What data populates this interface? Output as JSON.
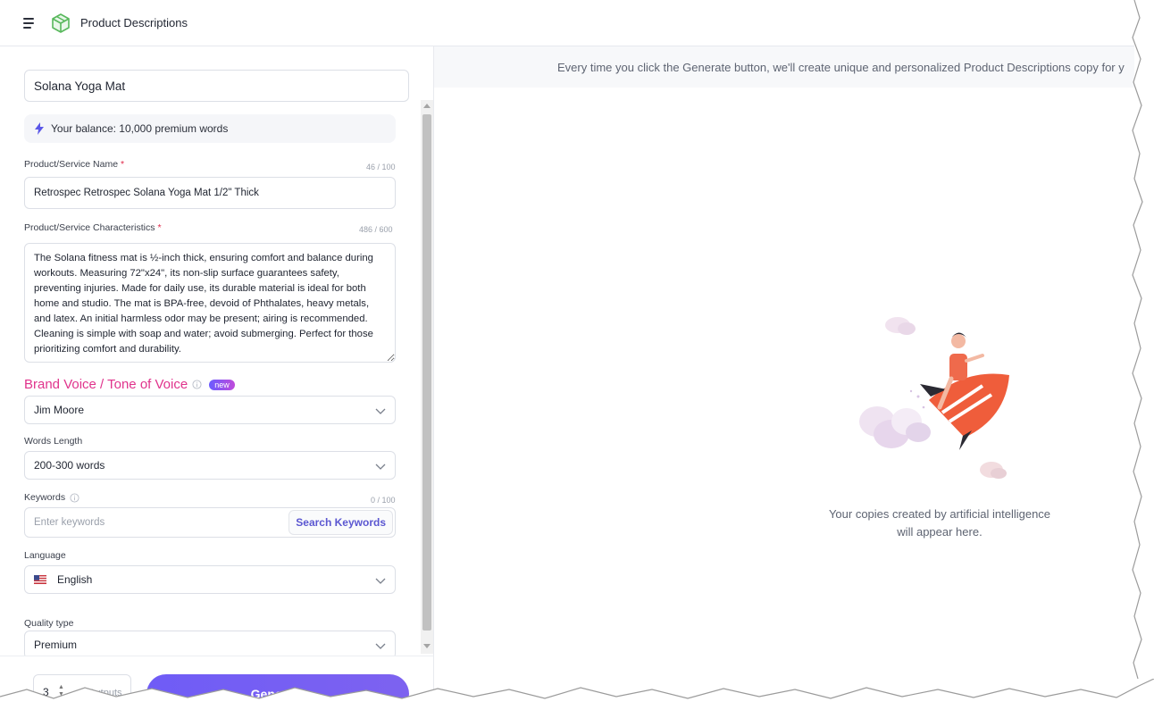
{
  "header": {
    "title": "Product Descriptions",
    "menu_icon": "hamburger-menu-icon",
    "logo_icon": "box-3d-icon"
  },
  "form": {
    "project_name": "Solana Yoga Mat",
    "balance_text": "Your balance: 10,000 premium words",
    "product_name": {
      "label": "Product/Service Name",
      "required_mark": "*",
      "counter": "46 / 100",
      "value": "Retrospec Retrospec Solana Yoga Mat 1/2\" Thick"
    },
    "characteristics": {
      "label": "Product/Service Characteristics",
      "required_mark": "*",
      "counter": "486 / 600",
      "value": "The Solana fitness mat is ½-inch thick, ensuring comfort and balance during workouts. Measuring 72\"x24\", its non-slip surface guarantees safety, preventing injuries. Made for daily use, its durable material is ideal for both home and studio. The mat is BPA-free, devoid of Phthalates, heavy metals, and latex. An initial harmless odor may be present; airing is recommended. Cleaning is simple with soap and water; avoid submerging. Perfect for those prioritizing comfort and durability."
    },
    "brand_voice": {
      "title": "Brand Voice / Tone of Voice",
      "badge": "new",
      "selected": "Jim Moore"
    },
    "words_length": {
      "label": "Words Length",
      "selected": "200-300 words"
    },
    "keywords": {
      "label": "Keywords",
      "counter": "0 / 100",
      "placeholder": "Enter keywords",
      "button": "Search Keywords"
    },
    "language": {
      "label": "Language",
      "selected": "English",
      "flag_icon": "us-flag-icon"
    },
    "quality_type": {
      "label": "Quality type",
      "selected": "Premium"
    }
  },
  "footer": {
    "outputs_value": "3",
    "outputs_label": "Outputs",
    "generate_label": "Generate"
  },
  "output_panel": {
    "banner": "Every time you click the Generate button, we'll create unique and personalized Product Descriptions copy for y",
    "empty_line_1": "Your copies created by artificial intelligence",
    "empty_line_2": "will appear here."
  },
  "colors": {
    "accent": "#6f5cf6",
    "brand_voice_pink": "#e0338c",
    "required_red": "#e0294a"
  }
}
